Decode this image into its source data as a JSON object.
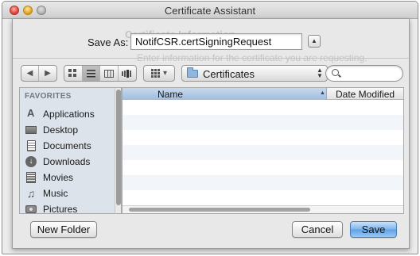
{
  "window": {
    "title": "Certificate Assistant"
  },
  "background": {
    "heading": "Certificate Information",
    "subtitle": "Enter information for the certificate you are requesting."
  },
  "save_as": {
    "label": "Save As:",
    "value": "NotifCSR.certSigningRequest"
  },
  "toolbar": {
    "back_glyph": "◀",
    "forward_glyph": "▶",
    "arrange_glyph": "▾",
    "location": "Certificates",
    "location_arrows": "▲▼",
    "expand_glyph": "▲"
  },
  "sidebar": {
    "header": "FAVORITES",
    "items": [
      {
        "label": "Applications",
        "icon": "applications-icon"
      },
      {
        "label": "Desktop",
        "icon": "desktop-icon"
      },
      {
        "label": "Documents",
        "icon": "documents-icon"
      },
      {
        "label": "Downloads",
        "icon": "downloads-icon"
      },
      {
        "label": "Movies",
        "icon": "movies-icon"
      },
      {
        "label": "Music",
        "icon": "music-icon"
      },
      {
        "label": "Pictures",
        "icon": "pictures-icon"
      }
    ]
  },
  "file_list": {
    "columns": [
      "Name",
      "Date Modified"
    ],
    "sort_glyph": "▲"
  },
  "buttons": {
    "new_folder": "New Folder",
    "cancel": "Cancel",
    "save": "Save"
  },
  "colors": {
    "accent": "#5da0e6",
    "selected_column": "#b3cbe8"
  }
}
